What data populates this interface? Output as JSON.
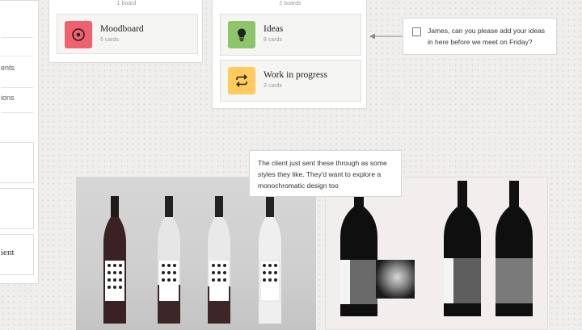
{
  "left_column": {
    "items": [
      "ents",
      "ions"
    ],
    "card_text": "ient"
  },
  "moodboard_board": {
    "count_label": "1 board",
    "card": {
      "title": "Moodboard",
      "subtitle": "6 cards",
      "icon": "target-icon",
      "color": "#f0616d"
    }
  },
  "ideas_board": {
    "count_label": "2 boards",
    "cards": [
      {
        "title": "Ideas",
        "subtitle": "8 cards",
        "icon": "lightbulb-icon",
        "color": "#8dc56b"
      },
      {
        "title": "Work in progress",
        "subtitle": "3 cards",
        "icon": "repeat-icon",
        "color": "#ffcb5c"
      }
    ]
  },
  "task_note": {
    "text": "James, can you please add your ideas in here before we meet on Friday?",
    "checked": false
  },
  "client_note": {
    "text": "The client just sent these through as some styles they like. They'd want to explore a monochromatic design too"
  }
}
